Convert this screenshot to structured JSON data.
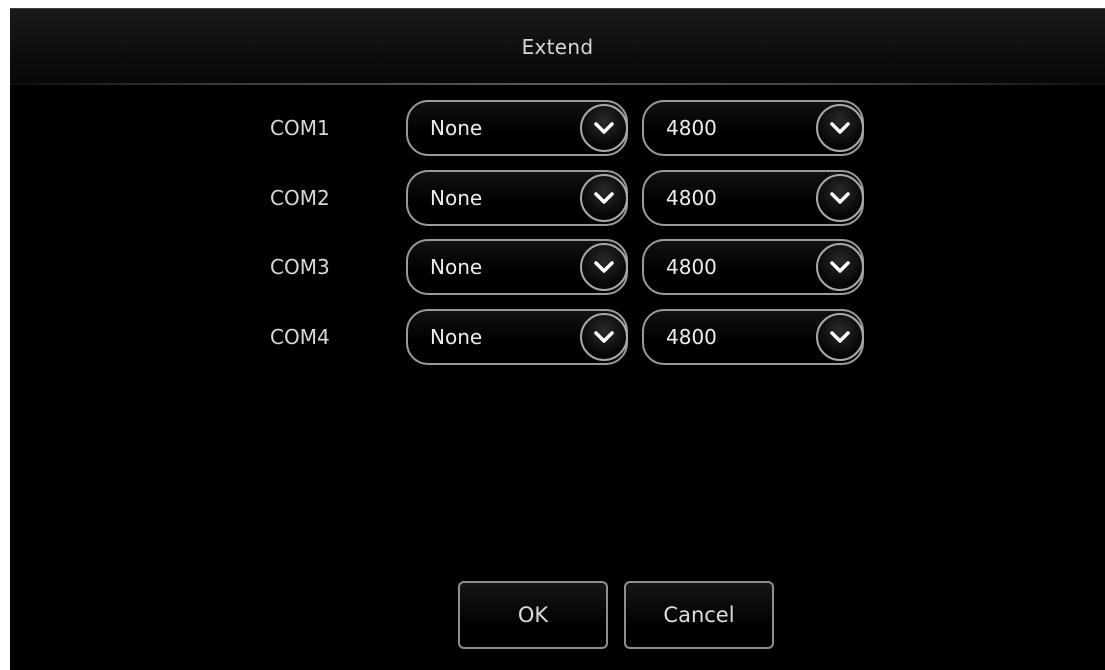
{
  "dialog": {
    "title": "Extend"
  },
  "ports": [
    {
      "label": "COM1",
      "protocol": "None",
      "baud_rate": "4800"
    },
    {
      "label": "COM2",
      "protocol": "None",
      "baud_rate": "4800"
    },
    {
      "label": "COM3",
      "protocol": "None",
      "baud_rate": "4800"
    },
    {
      "label": "COM4",
      "protocol": "None",
      "baud_rate": "4800"
    }
  ],
  "buttons": {
    "ok_label": "OK",
    "cancel_label": "Cancel"
  },
  "icons": {
    "dropdown": "chevron-down-icon"
  },
  "colors": {
    "background": "#000000",
    "text": "#dcdcdc",
    "border": "#9a9a9a"
  }
}
